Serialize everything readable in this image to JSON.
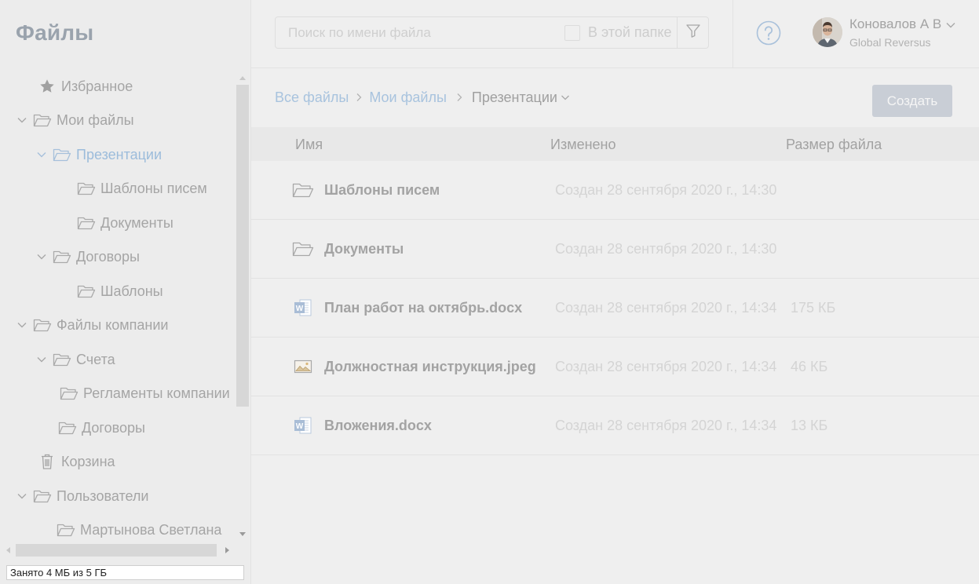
{
  "sidebar": {
    "title": "Файлы",
    "tree": [
      {
        "label": "Избранное",
        "icon": "star-icon",
        "expandable": false
      },
      {
        "label": "Мои файлы",
        "icon": "folder-icon",
        "expandable": true
      },
      {
        "label": "Презентации",
        "icon": "folder-icon",
        "expandable": true,
        "active": true
      },
      {
        "label": "Шаблоны писем",
        "icon": "folder-icon",
        "expandable": false
      },
      {
        "label": "Документы",
        "icon": "folder-icon",
        "expandable": false
      },
      {
        "label": "Договоры",
        "icon": "folder-icon",
        "expandable": true
      },
      {
        "label": "Шаблоны",
        "icon": "folder-icon",
        "expandable": false
      },
      {
        "label": "Файлы компании",
        "icon": "folder-icon",
        "expandable": true
      },
      {
        "label": "Счета",
        "icon": "folder-icon",
        "expandable": true
      },
      {
        "label": "Регламенты компании",
        "icon": "folder-icon",
        "expandable": false
      },
      {
        "label": "Договоры",
        "icon": "folder-icon",
        "expandable": false
      },
      {
        "label": "Корзина",
        "icon": "trash-icon",
        "expandable": false
      },
      {
        "label": "Пользователи",
        "icon": "folder-icon",
        "expandable": true
      },
      {
        "label": "Мартынова Светлана",
        "icon": "folder-icon",
        "expandable": false
      }
    ],
    "storage": "Занято 4 МБ из 5 ГБ"
  },
  "topbar": {
    "search_placeholder": "Поиск по имени файла",
    "search_value": "",
    "in_folder_label": "В этой папке",
    "in_folder_checked": false,
    "user_name": "Коновалов А В",
    "user_org": "Global Reversus"
  },
  "breadcrumb": {
    "items": [
      "Все файлы",
      "Мои файлы"
    ],
    "current": "Презентации"
  },
  "create_label": "Создать",
  "table": {
    "headers": {
      "name": "Имя",
      "modified": "Изменено",
      "size": "Размер файла"
    },
    "rows": [
      {
        "type": "folder",
        "icon": "folder-icon",
        "name": "Шаблоны писем",
        "modified": "Создан 28 сентября 2020 г., 14:30",
        "size": ""
      },
      {
        "type": "folder",
        "icon": "folder-icon",
        "name": "Документы",
        "modified": "Создан 28 сентября 2020 г., 14:30",
        "size": ""
      },
      {
        "type": "docx",
        "icon": "word-file-icon",
        "name": "План работ на октябрь.docx",
        "modified": "Создан 28 сентября 2020 г., 14:34",
        "size": "175 КБ"
      },
      {
        "type": "image",
        "icon": "image-file-icon",
        "name": "Должностная инструкция.jpeg",
        "modified": "Создан 28 сентября 2020 г., 14:34",
        "size": "46 КБ"
      },
      {
        "type": "docx",
        "icon": "word-file-icon",
        "name": "Вложения.docx",
        "modified": "Создан 28 сентября 2020 г., 14:34",
        "size": "13 КБ"
      }
    ]
  },
  "colors": {
    "accent_link": "#a8c3de",
    "create_button": "#c9ced6",
    "word_icon": "#a9bdd6"
  }
}
